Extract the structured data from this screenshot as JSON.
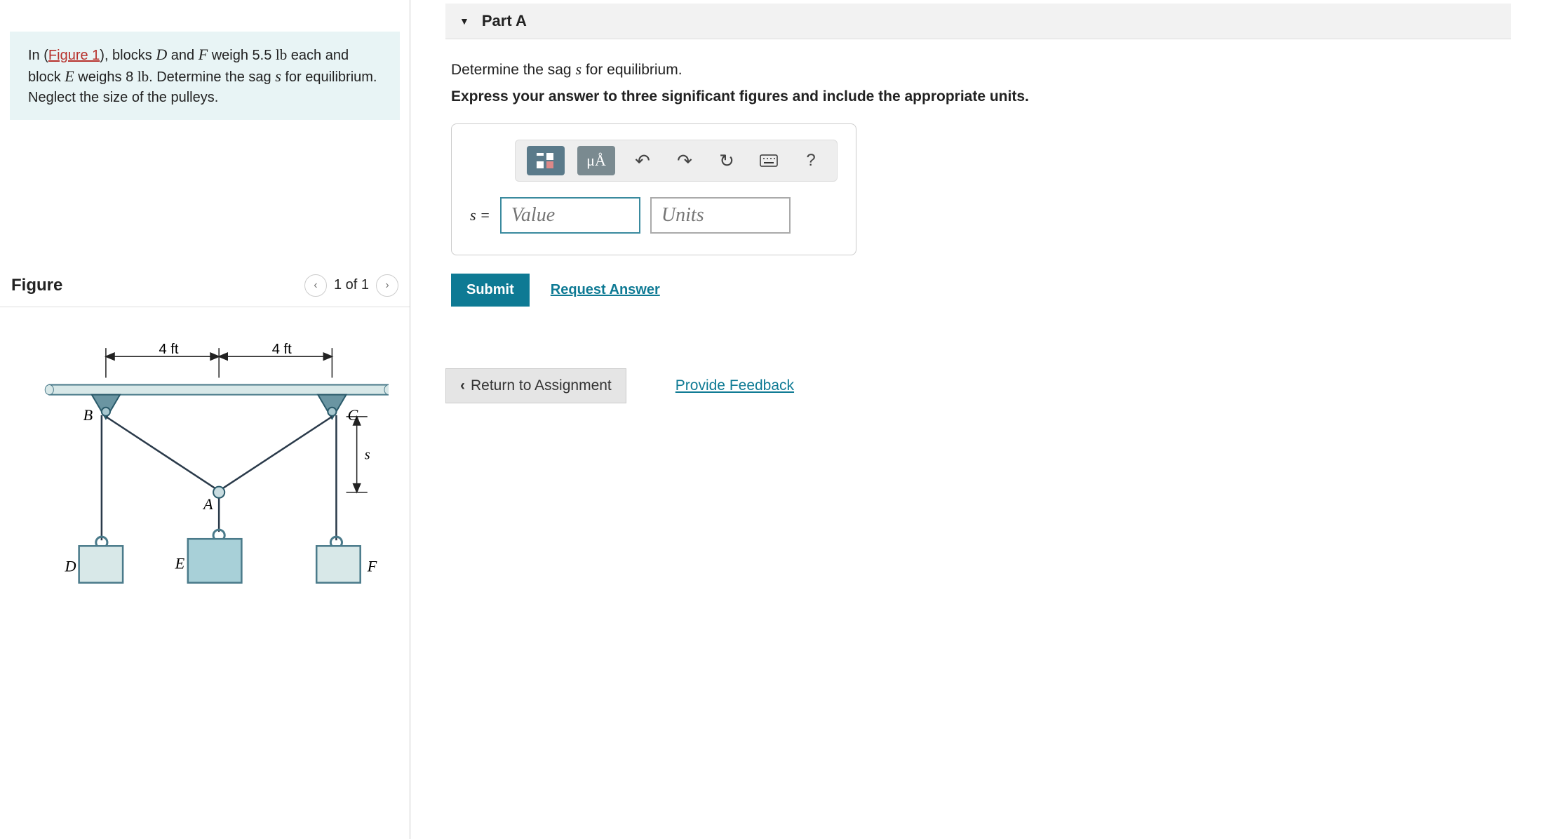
{
  "problem": {
    "figure_link": "Figure 1",
    "text_before": "In (",
    "text_after_link": "), blocks ",
    "var_D": "D",
    "and1": " and ",
    "var_F": "F",
    "weigh_text": " weigh 5.5 ",
    "unit1": "lb",
    "each_and": " each and block ",
    "var_E": "E",
    "weighs": " weighs 8 ",
    "unit2": "lb",
    "det": ". Determine the sag ",
    "var_s": "s",
    "for_eq": " for equilibrium. Neglect the size of the pulleys."
  },
  "figure": {
    "title": "Figure",
    "pager_text": "1 of 1",
    "dim1": "4 ft",
    "dim2": "4 ft",
    "labels": {
      "A": "A",
      "B": "B",
      "C": "C",
      "D": "D",
      "E": "E",
      "F": "F",
      "s": "s"
    }
  },
  "part": {
    "label": "Part A",
    "question_pre": "Determine the sag ",
    "question_var": "s",
    "question_post": " for equilibrium.",
    "instruction": "Express your answer to three significant figures and include the appropriate units.",
    "var_label": "s =",
    "value_placeholder": "Value",
    "units_placeholder": "Units",
    "submit": "Submit",
    "request": "Request Answer",
    "greek_label": "μÅ",
    "help_label": "?"
  },
  "footer": {
    "return": "Return to Assignment",
    "feedback": "Provide Feedback"
  }
}
